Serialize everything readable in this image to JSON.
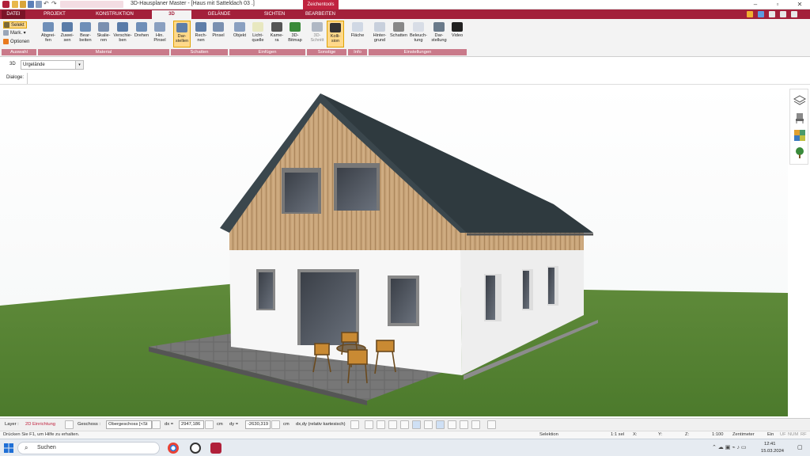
{
  "titlebar": {
    "title": "3D-Hausplaner Master - [Haus mit Satteldach 03 .]",
    "context_tab": "Zeichentools",
    "minimize": "–",
    "maximize": "▫",
    "close": "✕"
  },
  "tabs": {
    "datei": "DATEI",
    "projekt": "PROJEKT",
    "konstruktion": "KONSTRUKTION",
    "d3": "3D",
    "gelaende": "GELÄNDE",
    "sichten": "SICHTEN",
    "bearbeiten": "BEARBEITEN"
  },
  "ribbon": {
    "auswahl": {
      "selekt": "Selekt",
      "mark": "Mark.",
      "optionen": "Optionen",
      "group": "Auswahl"
    },
    "material": {
      "buttons": [
        "Abgrei-\nfen",
        "Zuwei-\nsen",
        "Bear-\nbeiten",
        "Skalie-\nren",
        "Verschie-\nben",
        "Drehen",
        "Hin.\nPinsel"
      ],
      "group": "Material"
    },
    "schatten": {
      "buttons": [
        "Dar-\nstellen",
        "Rech-\nnen",
        "Pinsel"
      ],
      "group": "Schatten"
    },
    "einfuegen": {
      "buttons": [
        "Objekt",
        "Licht-\nquelle",
        "Kame-\nra",
        "3D-\nBitmap"
      ],
      "group": "Einfügen"
    },
    "sonstige": {
      "buttons": [
        "3D-\nSchnitt",
        "Kolli-\nsion"
      ],
      "group": "Sonstige"
    },
    "info": {
      "buttons": [
        "Fläche"
      ],
      "group": "Info"
    },
    "einstellungen": {
      "buttons": [
        "Hinter-\ngrund",
        "Schatten",
        "Beleuch-\ntung",
        "Dar-\nstellung",
        "Video"
      ],
      "group": "Einstellungen"
    }
  },
  "row3d": {
    "label": "3D",
    "combo_value": "Urgelände"
  },
  "dialoge": {
    "label": "Dialoge:"
  },
  "statusbar": {
    "layer_label": "Layer :",
    "layer_value": "2D Einrichtung",
    "geschoss_label": "Geschoss :",
    "geschoss_value": "Obergeschoss [<St",
    "dx_label": "dx =",
    "dx_value": "2947,186",
    "dx_unit": "cm",
    "dy_label": "dy =",
    "dy_value": "-2630,319",
    "dy_unit": "cm",
    "coord_mode": "dx,dy (relativ kartesisch)"
  },
  "infobar": {
    "help": "Drücken Sie F1, um Hilfe zu erhalten.",
    "mode": "Selektion",
    "scale_sel": "1:1 sel",
    "x": "X:",
    "y": "Y:",
    "z": "Z:",
    "scale": "1:100",
    "unit": "Zentimeter",
    "ein": "Ein",
    "uf": "UF",
    "num": "NUM",
    "rf": "RF"
  },
  "taskbar": {
    "search": "Suchen",
    "time": "12:41",
    "date": "15.03.2024"
  },
  "colors": {
    "accent": "#a3203a",
    "ribbon_group": "#c97a8a",
    "active_button": "#ffd98a"
  }
}
